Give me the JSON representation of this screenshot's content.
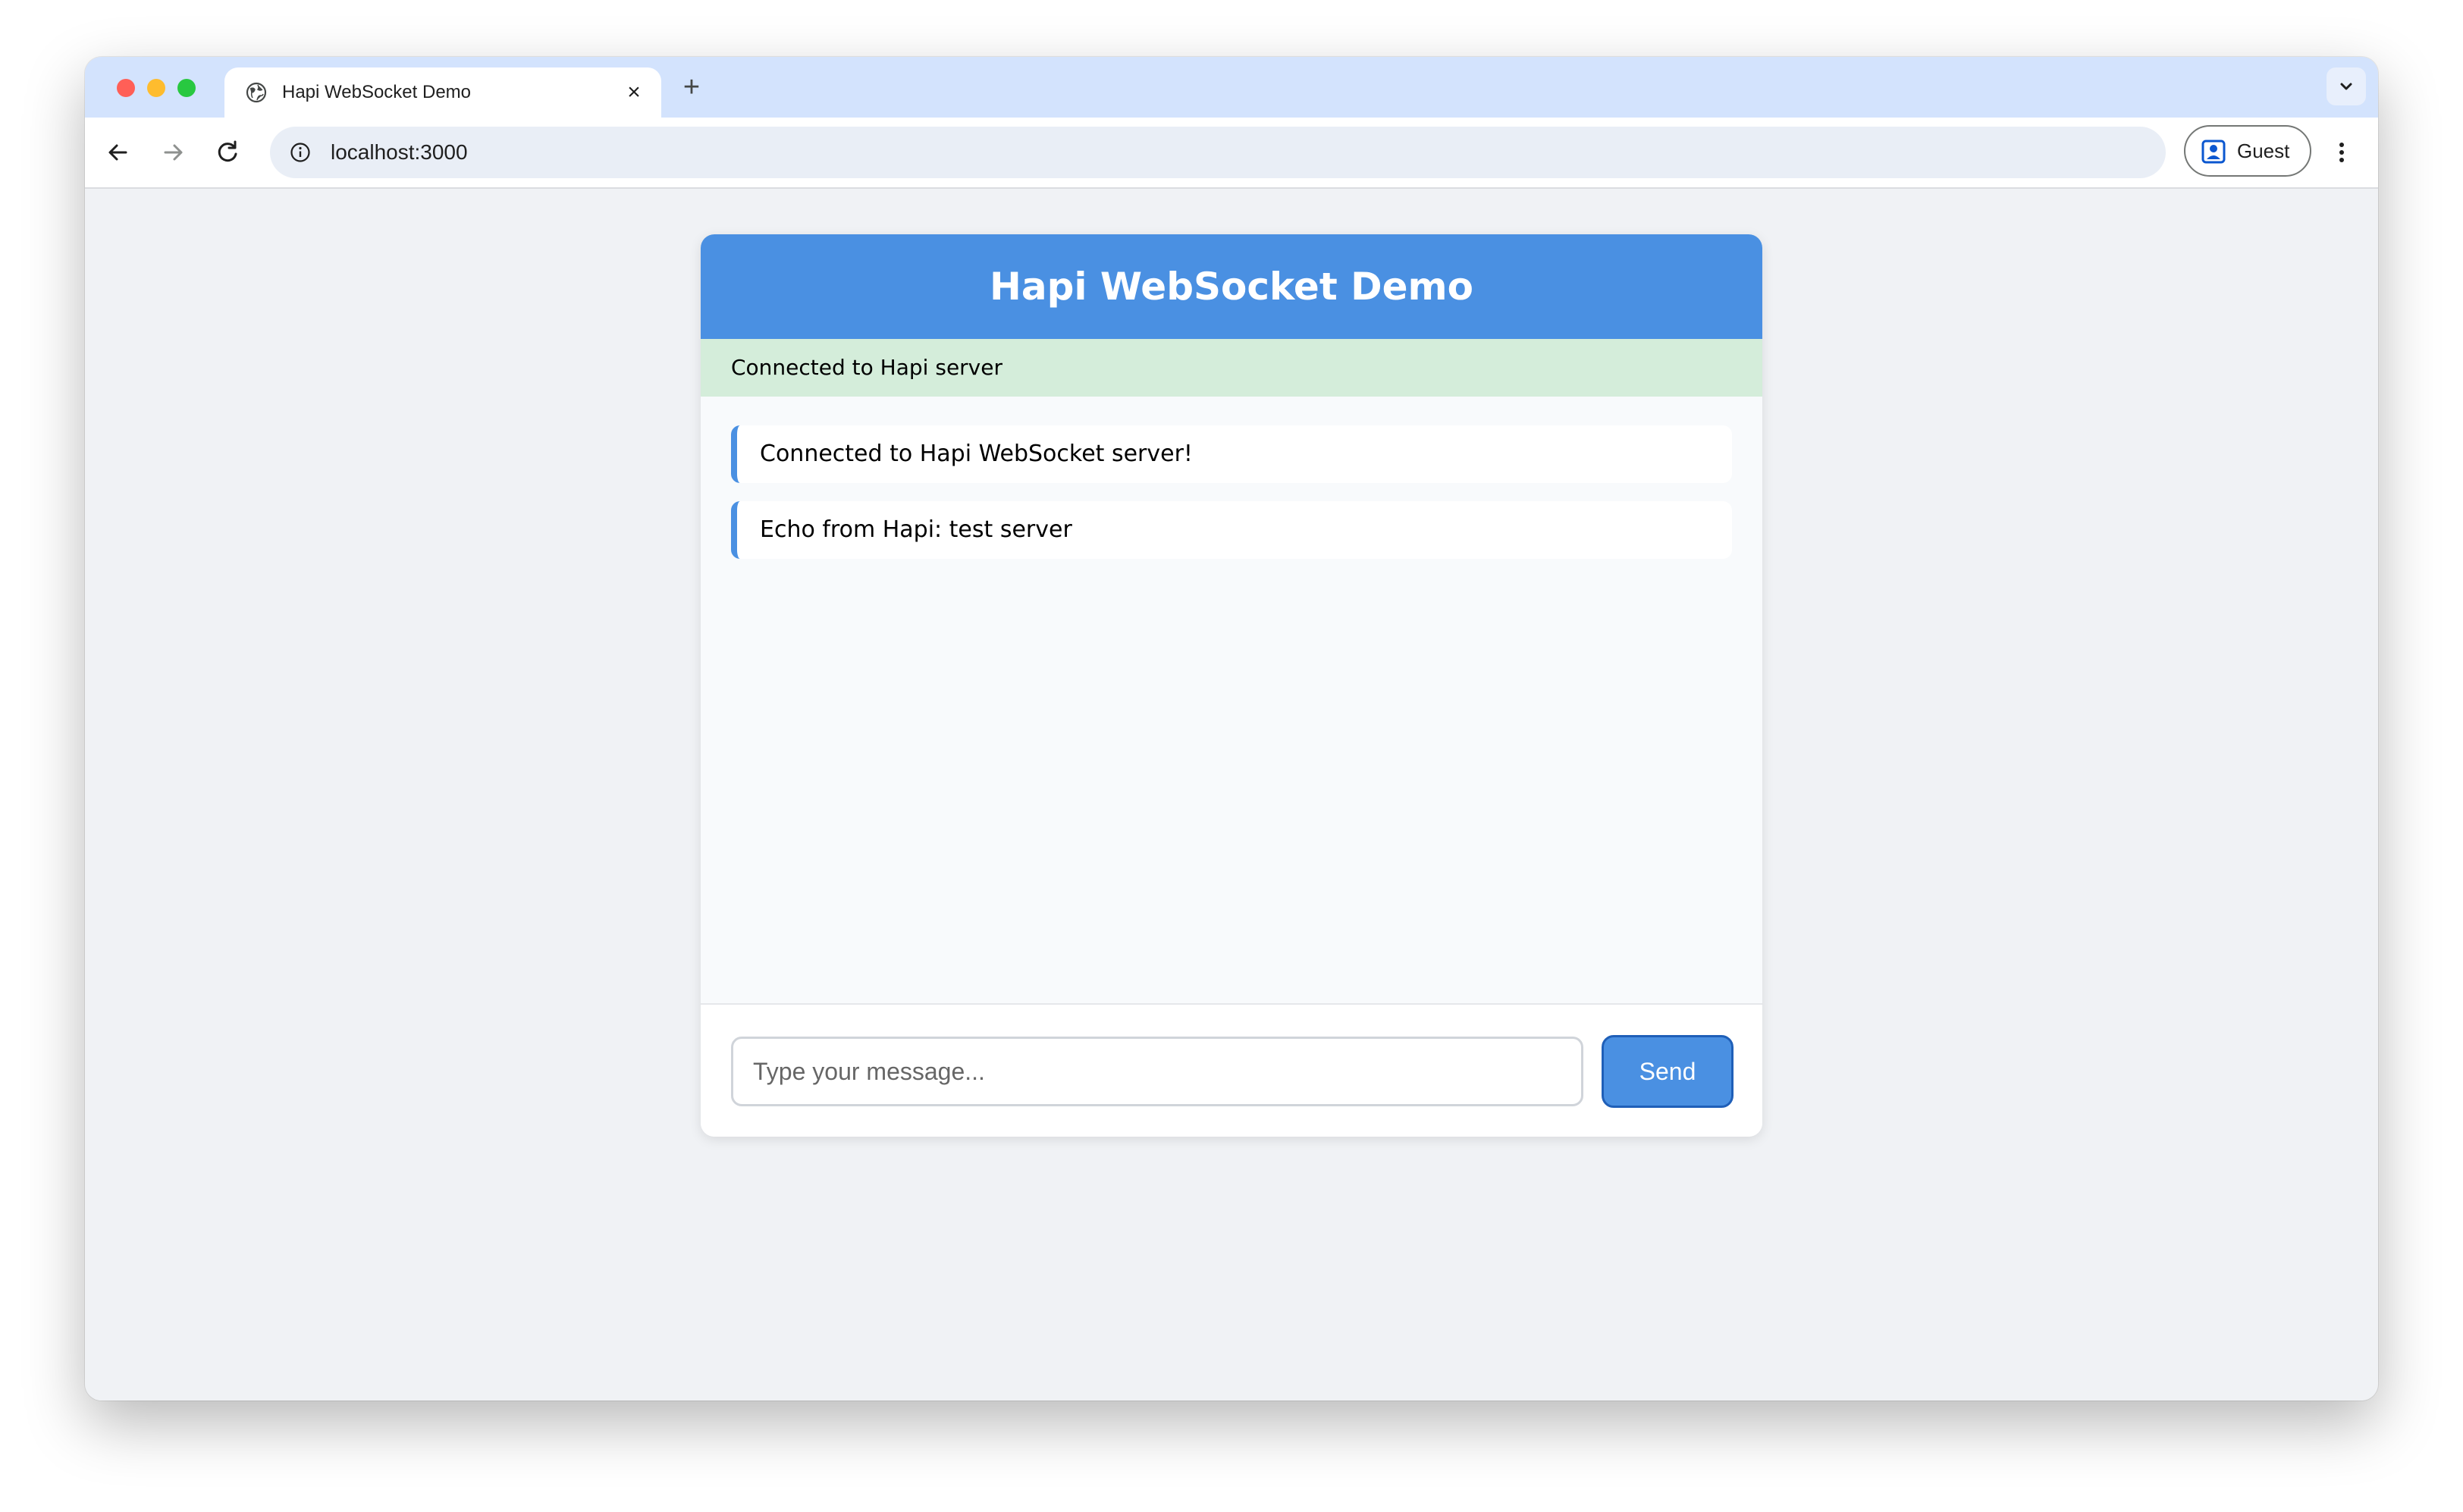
{
  "browser": {
    "tab": {
      "title": "Hapi WebSocket Demo"
    },
    "address_bar": {
      "url": "localhost:3000"
    },
    "profile": {
      "label": "Guest"
    }
  },
  "app": {
    "title": "Hapi WebSocket Demo",
    "status": "Connected to Hapi server",
    "messages": [
      "Connected to Hapi WebSocket server!",
      "Echo from Hapi: test server"
    ],
    "input": {
      "placeholder": "Type your message...",
      "value": ""
    },
    "send_label": "Send"
  },
  "colors": {
    "header": "#4a90e2",
    "status_bg": "#d4edda",
    "accent": "#4a90e2"
  }
}
